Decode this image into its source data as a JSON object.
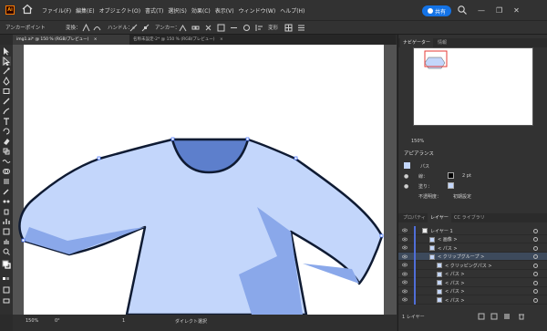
{
  "app": {
    "logo": "Ai"
  },
  "menu": [
    "ファイル(F)",
    "編集(E)",
    "オブジェクト(O)",
    "書式(T)",
    "選択(S)",
    "効果(C)",
    "表示(V)",
    "ウィンドウ(W)",
    "ヘルプ(H)"
  ],
  "share_label": "共有",
  "window_controls": {
    "minimize": "—",
    "maximize": "❐",
    "close": "✕"
  },
  "control_bar": {
    "anchor_point_label": "アンカーポイント",
    "convert_label": "変換：",
    "handle_label": "ハンドル：",
    "anchor_label": "アンカー：",
    "transform_label": "変形"
  },
  "tabs": [
    {
      "label": "img1.ai* @ 150 % (RGB/プレビュー)",
      "close": "×"
    },
    {
      "label": "名称未設定-2* @ 150 % (RGB/プレビュー)",
      "close": "×"
    }
  ],
  "status": {
    "zoom": "150%",
    "rotation": "0°",
    "page": "1",
    "tool": "ダイレクト選択"
  },
  "panels": {
    "navigator_tab": "ナビゲーター",
    "info_tab": "情報",
    "nav_zoom": "150%",
    "appearance_title": "アピアランス",
    "path_label": "パス",
    "stroke_label": "線：",
    "stroke_value": "2 pt",
    "fill_label": "塗り：",
    "opacity_label": "不透明度：",
    "opacity_value": "初期設定",
    "properties_tab": "プロパティ",
    "layers_tab": "レイヤー",
    "libraries_tab": "CC ライブラリ",
    "layers_count": "1 レイヤー"
  },
  "layers": [
    {
      "name": "レイヤー 1",
      "indent": 0,
      "selected": false
    },
    {
      "name": "< 画像 >",
      "indent": 1,
      "selected": false
    },
    {
      "name": "< パス >",
      "indent": 1,
      "selected": false
    },
    {
      "name": "< クリップグループ >",
      "indent": 1,
      "selected": true
    },
    {
      "name": "< クリッピングパス >",
      "indent": 2,
      "selected": false
    },
    {
      "name": "< パス >",
      "indent": 2,
      "selected": false
    },
    {
      "name": "< パス >",
      "indent": 2,
      "selected": false
    },
    {
      "name": "< パス >",
      "indent": 2,
      "selected": false
    },
    {
      "name": "< パス >",
      "indent": 2,
      "selected": false
    }
  ],
  "colors": {
    "shirt_light": "#c3d6fb",
    "shirt_shade": "#8aa8ea",
    "collar": "#5d7fcc",
    "accent": "#1473e6"
  }
}
